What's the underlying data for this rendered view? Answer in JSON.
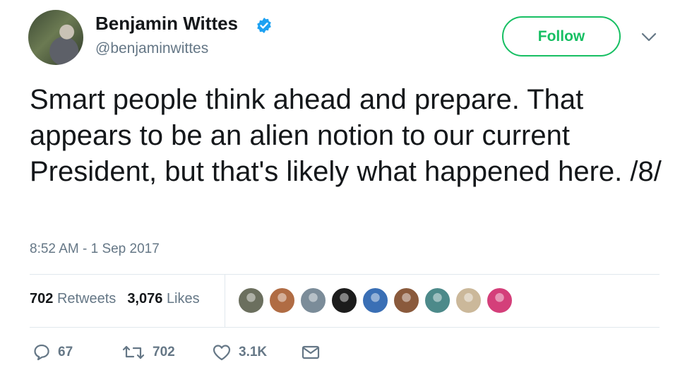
{
  "user": {
    "name": "Benjamin Wittes",
    "handle": "@benjaminwittes",
    "verified": true,
    "avatar_icon": "profile-photo"
  },
  "follow": {
    "label": "Follow",
    "color": "#17bf63"
  },
  "more_icon": "chevron-down-icon",
  "tweet": {
    "text": "Smart people think ahead and prepare. That appears to be an alien notion to our current President, but that's likely what happened here. /8/",
    "timestamp": "8:52 AM - 1 Sep 2017"
  },
  "stats": {
    "retweets_count": "702",
    "retweets_label": "Retweets",
    "likes_count": "3,076",
    "likes_label": "Likes"
  },
  "likers": [
    {
      "color": "#6b6f5e"
    },
    {
      "color": "#b06c44"
    },
    {
      "color": "#7b8c99"
    },
    {
      "color": "#1c1c1c"
    },
    {
      "color": "#3a6fb5"
    },
    {
      "color": "#8a5a3c"
    },
    {
      "color": "#4d8a8a"
    },
    {
      "color": "#cbb89a"
    },
    {
      "color": "#d43f7a"
    }
  ],
  "actions": {
    "reply_count": "67",
    "retweet_count": "702",
    "like_count": "3.1K",
    "icons": [
      "reply-icon",
      "retweet-icon",
      "heart-icon",
      "message-icon"
    ]
  },
  "colors": {
    "muted": "#657786",
    "text": "#14171a",
    "verified": "#1da1f2"
  }
}
